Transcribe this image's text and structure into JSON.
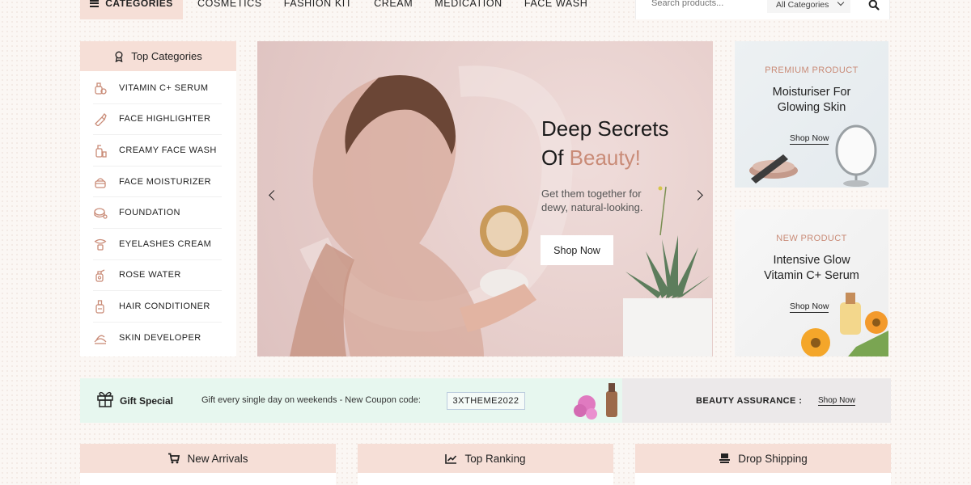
{
  "nav": {
    "categories_label": "CATEGORIES",
    "menu": [
      "COSMETICS",
      "FASHION KIT",
      "CREAM",
      "MEDICATION",
      "FACE WASH"
    ]
  },
  "search": {
    "placeholder": "Search products...",
    "category": "All Categories"
  },
  "sidebar": {
    "title": "Top Categories",
    "items": [
      {
        "label": "VITAMIN C+ SERUM",
        "icon": "serum-icon"
      },
      {
        "label": "FACE HIGHLIGHTER",
        "icon": "highlighter-icon"
      },
      {
        "label": "CREAMY FACE WASH",
        "icon": "face-wash-icon"
      },
      {
        "label": "FACE MOISTURIZER",
        "icon": "moisturizer-icon"
      },
      {
        "label": "FOUNDATION",
        "icon": "foundation-icon"
      },
      {
        "label": "EYELASHES CREAM",
        "icon": "eyelash-icon"
      },
      {
        "label": "ROSE WATER",
        "icon": "rose-water-icon"
      },
      {
        "label": "HAIR CONDITIONER",
        "icon": "conditioner-icon"
      },
      {
        "label": "SKIN DEVELOPER",
        "icon": "skin-developer-icon"
      }
    ]
  },
  "hero": {
    "title_line1": "Deep Secrets",
    "title_of": "Of ",
    "title_accent": "Beauty!",
    "subtitle": "Get them together for dewy, natural-looking.",
    "button": "Shop Now"
  },
  "promo": [
    {
      "tag": "PREMIUM PRODUCT",
      "title": "Moisturiser For Glowing Skin",
      "link": "Shop Now"
    },
    {
      "tag": "NEW PRODUCT",
      "title": "Intensive Glow Vitamin C+ Serum",
      "link": "Shop Now"
    }
  ],
  "gift": {
    "label": "Gift Special",
    "message": "Gift every single day on weekends -  New Coupon code:",
    "coupon": "3XTHEME2022",
    "assurance": "BEAUTY ASSURANCE :",
    "assurance_link": "Shop Now"
  },
  "tabs": [
    {
      "label": "New Arrivals",
      "icon": "cart-icon"
    },
    {
      "label": "Top Ranking",
      "icon": "trend-chart-icon"
    },
    {
      "label": "Drop Shipping",
      "icon": "shipping-icon"
    }
  ],
  "colors": {
    "accent": "#c98b77",
    "header_bg": "#f6dfd7",
    "gift_bg": "#e7f7ef"
  }
}
